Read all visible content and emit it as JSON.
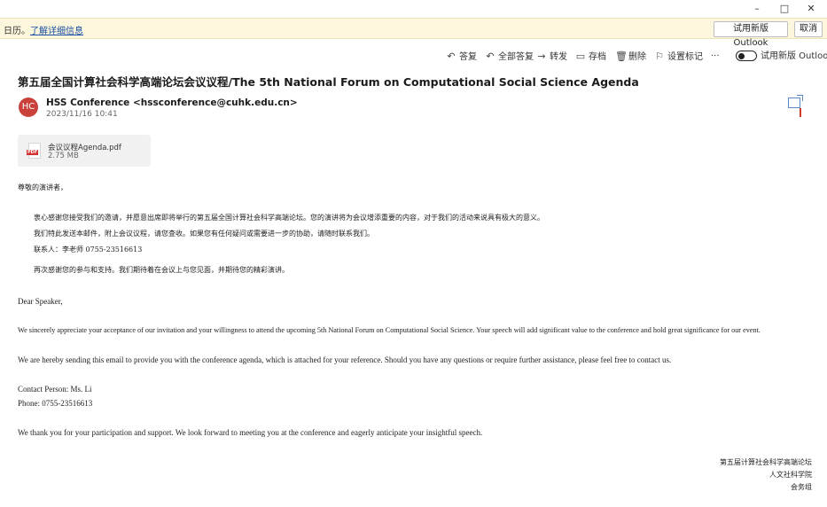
{
  "window": {
    "minimize_glyph": "–",
    "maximize_glyph": "□",
    "close_glyph": "✕"
  },
  "infobar": {
    "prefix_text": "日历。",
    "link_text": "了解详细信息",
    "try_new_outlook": "试用新版 Outlook",
    "cancel": "取消"
  },
  "toolbar": {
    "reply": "答复",
    "reply_all": "全部答复",
    "forward": "转发",
    "archive": "存档",
    "delete": "删除",
    "flag": "设置标记",
    "more": "···",
    "toggle_label": "试用新版 Outlook",
    "icons": [
      "reply-icon",
      "reply-all-icon",
      "forward-icon",
      "archive-icon",
      "delete-icon",
      "flag-icon",
      "more-icon",
      "toggle-icon"
    ]
  },
  "email": {
    "subject": "第五届全国计算社会科学高端论坛会议议程/The 5th National Forum on Computational Social Science Agenda",
    "avatar_initials": "HC",
    "avatar_color": "#c9413a",
    "sender": "HSS Conference <hssconference@cuhk.edu.cn>",
    "date": "2023/11/16 10:41",
    "attachment": {
      "name": "会议议程Agenda.pdf",
      "size": "2.75 MB",
      "type_tag": "PDF"
    },
    "body_cn": {
      "greeting": "尊敬的演讲者，",
      "p1": "衷心感谢您接受我们的邀请，并愿意出席即将举行的第五届全国计算社会科学高端论坛。您的演讲将为会议增添重要的内容，对于我们的活动来说具有极大的意义。",
      "p2": "我们特此发送本邮件，附上会议议程，请您查收。如果您有任何疑问或需要进一步的协助，请随时联系我们。",
      "p3": "联系人：李老师 0755-23516613",
      "p4": "再次感谢您的参与和支持。我们期待着在会议上与您见面，并期待您的精彩演讲。"
    },
    "body_en": {
      "greeting": "Dear Speaker,",
      "p1": "We sincerely appreciate your acceptance of our invitation and your willingness to attend the upcoming 5th National Forum on Computational Social Science. Your speech will add significant value to the conference and hold great significance for our event.",
      "p2": "We are hereby sending this email to provide you with the conference agenda, which is attached for your reference. Should you have any questions or require further assistance, please feel free to contact us.",
      "contact": "Contact Person: Ms. Li",
      "phone": "Phone: 0755-23516613",
      "p3": "We thank you for your participation and support. We look forward to meeting you at the conference and eagerly anticipate your insightful speech."
    },
    "signature": {
      "line1": "第五届计算社会科学高端论坛",
      "line2": "人文社科学院",
      "line3": "会务组"
    }
  }
}
